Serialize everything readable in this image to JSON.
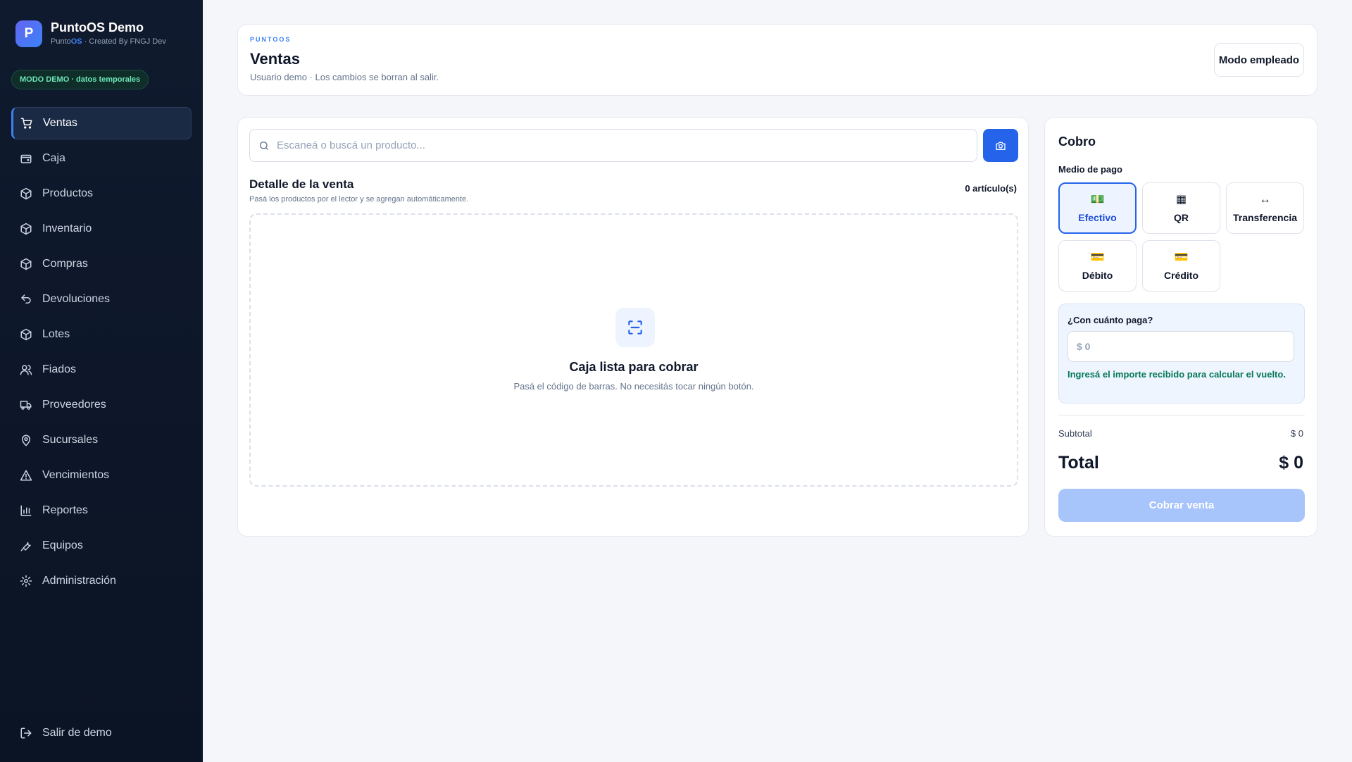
{
  "brand": {
    "logo_letter": "P",
    "name": "PuntoOS Demo",
    "sub_prefix": "Punto",
    "sub_os": "OS",
    "sub_suffix": " · Created By FNGJ Dev"
  },
  "demo_badge": "MODO DEMO · datos temporales",
  "sidebar": {
    "items": [
      {
        "label": "Ventas",
        "icon": "cart-icon"
      },
      {
        "label": "Caja",
        "icon": "wallet-icon"
      },
      {
        "label": "Productos",
        "icon": "box-icon"
      },
      {
        "label": "Inventario",
        "icon": "box-icon"
      },
      {
        "label": "Compras",
        "icon": "box-icon"
      },
      {
        "label": "Devoluciones",
        "icon": "undo-icon"
      },
      {
        "label": "Lotes",
        "icon": "box-icon"
      },
      {
        "label": "Fiados",
        "icon": "users-icon"
      },
      {
        "label": "Proveedores",
        "icon": "truck-icon"
      },
      {
        "label": "Sucursales",
        "icon": "map-pin-icon"
      },
      {
        "label": "Vencimientos",
        "icon": "warning-icon"
      },
      {
        "label": "Reportes",
        "icon": "bar-chart-icon"
      },
      {
        "label": "Equipos",
        "icon": "tools-icon"
      },
      {
        "label": "Administración",
        "icon": "gear-icon"
      }
    ],
    "active": "Ventas",
    "logout_label": "Salir de demo"
  },
  "header": {
    "eyebrow": "PUNTOOS",
    "title": "Ventas",
    "subtitle": "Usuario demo · Los cambios se borran al salir.",
    "mode_button": "Modo empleado"
  },
  "sale": {
    "search_placeholder": "Escaneá o buscá un producto...",
    "detail_title": "Detalle de la venta",
    "detail_sub": "Pasá los productos por el lector y se agregan automáticamente.",
    "count": "0 artículo(s)",
    "empty_title": "Caja lista para cobrar",
    "empty_sub": "Pasá el código de barras. No necesitás tocar ningún botón."
  },
  "payment": {
    "title": "Cobro",
    "method_label": "Medio de pago",
    "methods": [
      {
        "label": "Efectivo",
        "glyph": "💵",
        "active": true
      },
      {
        "label": "QR",
        "glyph": "▦",
        "active": false
      },
      {
        "label": "Transferencia",
        "glyph": "↔",
        "active": false
      },
      {
        "label": "Débito",
        "glyph": "💳",
        "active": false
      },
      {
        "label": "Crédito",
        "glyph": "💳",
        "active": false
      }
    ],
    "amount_label": "¿Con cuánto paga?",
    "amount_placeholder": "$ 0",
    "amount_hint": "Ingresá el importe recibido para calcular el vuelto.",
    "subtotal_label": "Subtotal",
    "subtotal_value": "$ 0",
    "total_label": "Total",
    "total_value": "$ 0",
    "submit_label": "Cobrar venta"
  },
  "colors": {
    "accent": "#2563eb",
    "sidebar_bg": "#0f1a2e",
    "success_text": "#047857",
    "disabled_button": "#a7c4fb"
  }
}
